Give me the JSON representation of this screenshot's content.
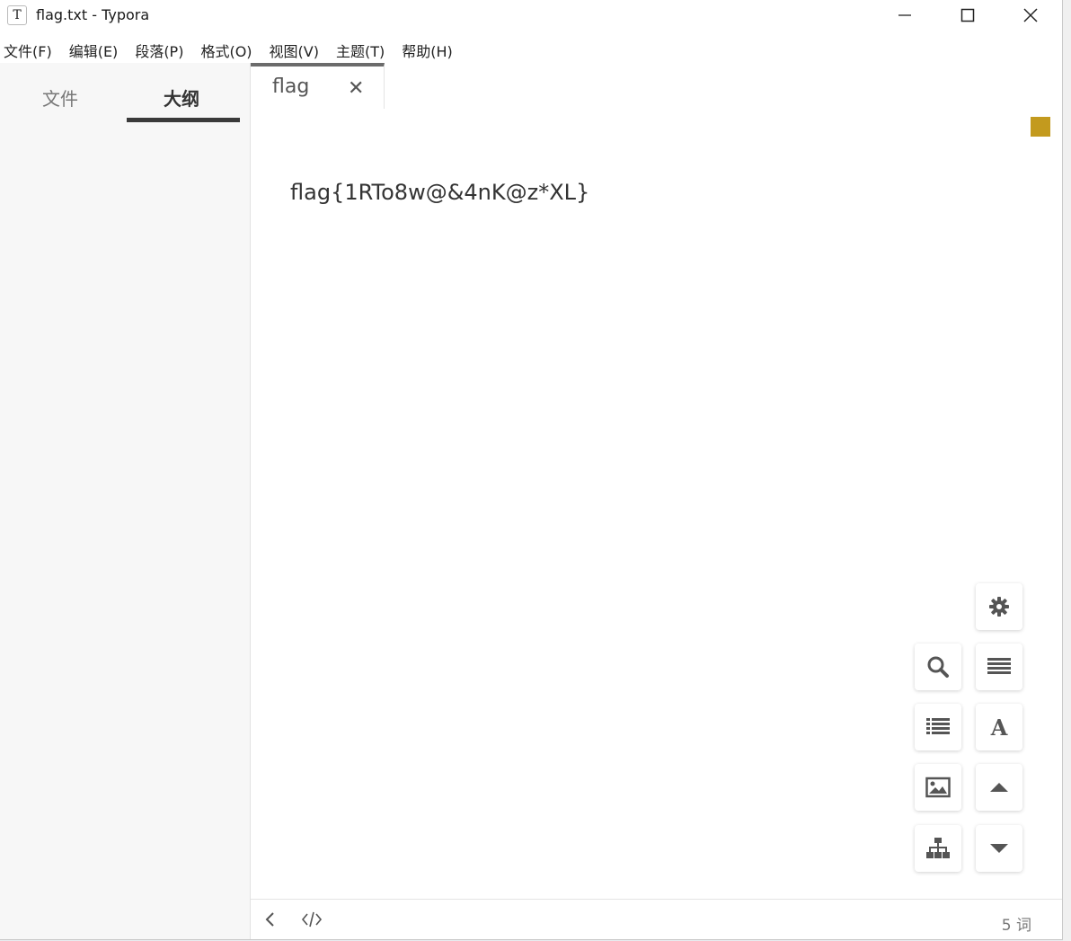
{
  "window": {
    "title": "flag.txt - Typora",
    "app_icon_letter": "T"
  },
  "menu": [
    "文件(F)",
    "编辑(E)",
    "段落(P)",
    "格式(O)",
    "视图(V)",
    "主题(T)",
    "帮助(H)"
  ],
  "sidebar": {
    "tab_files": "文件",
    "tab_outline": "大纲",
    "active_tab": "大纲"
  },
  "tabs": [
    {
      "label": "flag",
      "close_glyph": "✕",
      "active": true
    }
  ],
  "editor": {
    "content": "flag{1RTo8w@&4nK@z*XL}",
    "sync_indicator_color": "#c39a1e"
  },
  "toolbar": {
    "icons": [
      "gear-icon",
      "search-icon",
      "paragraph-icon",
      "list-icon",
      "font-icon",
      "image-icon",
      "arrow-up-icon",
      "tree-icon",
      "arrow-down-icon"
    ]
  },
  "statusbar": {
    "word_count": "5 词"
  },
  "colors": {
    "sidebar_bg": "#f7f7f7",
    "text": "#333333",
    "icon": "#555555",
    "accent": "#c39a1e"
  }
}
